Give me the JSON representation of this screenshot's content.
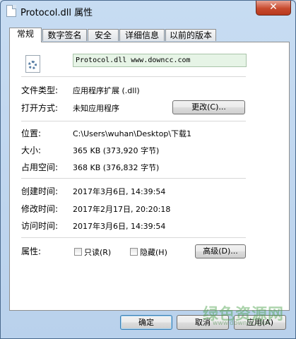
{
  "window": {
    "title": "Protocol.dll 属性",
    "close_glyph": "✕"
  },
  "tabs": [
    {
      "label": "常规"
    },
    {
      "label": "数字签名"
    },
    {
      "label": "安全"
    },
    {
      "label": "详细信息"
    },
    {
      "label": "以前的版本"
    }
  ],
  "general": {
    "file_icon": "dll-file-gear-icon",
    "file_name": "Protocol.dll  www.downcc.com",
    "file_type_label": "文件类型:",
    "file_type_value": "应用程序扩展 (.dll)",
    "open_with_label": "打开方式:",
    "open_with_value": "未知应用程序",
    "change_button": "更改(C)...",
    "location_label": "位置:",
    "location_value": "C:\\Users\\wuhan\\Desktop\\下载1",
    "size_label": "大小:",
    "size_value": "365 KB (373,920 字节)",
    "size_on_disk_label": "占用空间:",
    "size_on_disk_value": "368 KB (376,832 字节)",
    "created_label": "创建时间:",
    "created_value": "2017年3月6日, 14:39:54",
    "modified_label": "修改时间:",
    "modified_value": "2017年2月17日, 20:20:18",
    "accessed_label": "访问时间:",
    "accessed_value": "2017年3月6日, 14:39:54",
    "attributes_label": "属性:",
    "readonly_label": "只读(R)",
    "hidden_label": "隐藏(H)",
    "readonly_checked": false,
    "hidden_checked": false,
    "advanced_button": "高级(D)..."
  },
  "footer": {
    "ok": "确定",
    "cancel": "取消",
    "apply": "应用(A)"
  },
  "watermark": {
    "text": "绿色资源网",
    "url": "www.downcc.com"
  }
}
